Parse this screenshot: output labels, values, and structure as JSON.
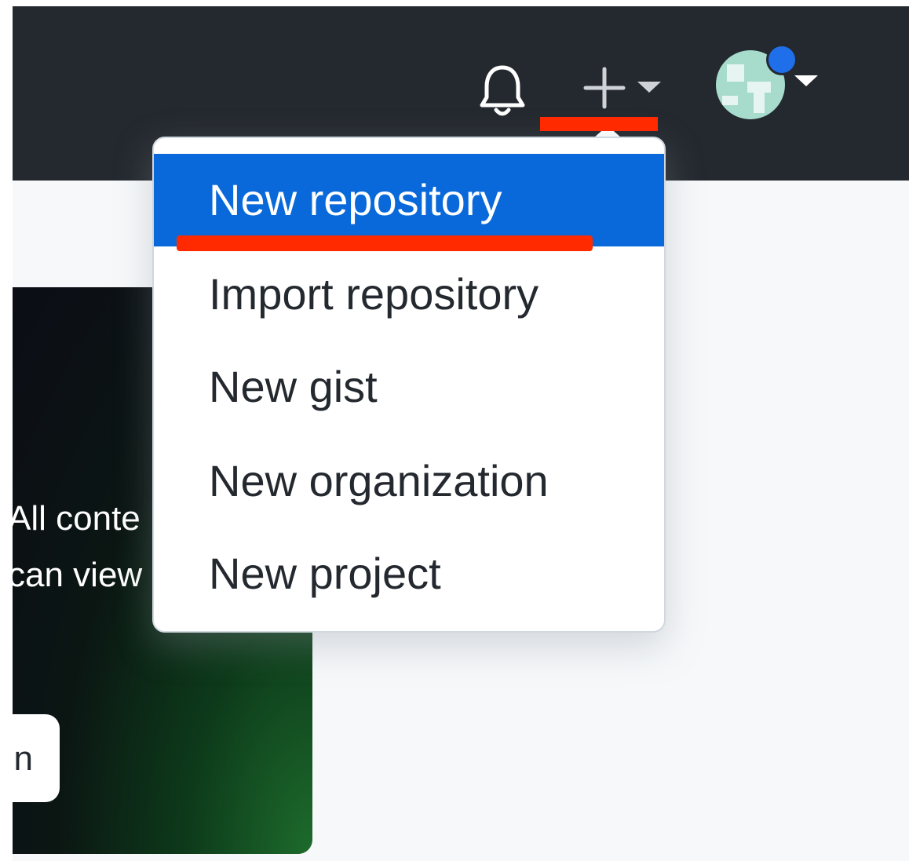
{
  "header": {
    "icons": {
      "notifications": "bell-icon",
      "create": "plus-icon",
      "create_caret": "chevron-down-icon",
      "avatar_caret": "chevron-down-icon"
    },
    "colors": {
      "header_bg": "#24292f",
      "status_dot": "#1f6feb"
    }
  },
  "promo": {
    "line1": "All conte",
    "line2": "can view",
    "button_label": "n"
  },
  "dropdown": {
    "items": [
      {
        "label": "New repository",
        "highlighted": true
      },
      {
        "label": "Import repository",
        "highlighted": false
      },
      {
        "label": "New gist",
        "highlighted": false
      },
      {
        "label": "New organization",
        "highlighted": false
      },
      {
        "label": "New project",
        "highlighted": false
      }
    ],
    "highlight_color": "#0969da"
  },
  "annotations": {
    "color": "#ff2a00"
  }
}
